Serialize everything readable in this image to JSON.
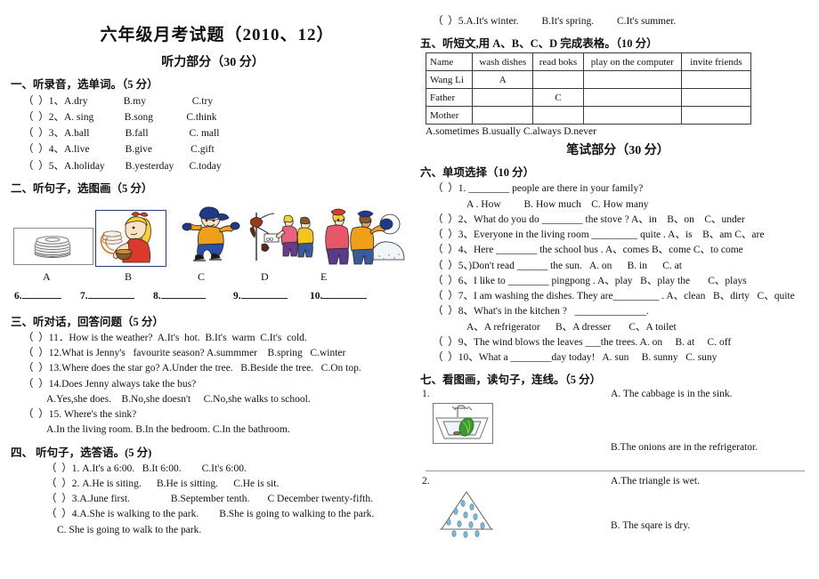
{
  "title": "六年级月考试题（2010、12）",
  "parts": {
    "listening": "听力部分（30 分）",
    "written": "笔试部分（30 分）"
  },
  "section1": {
    "heading": "一、听录音，选单词。（5 分）",
    "items": [
      "（  ）1、A.dry              B.my                  C.try",
      "（  ）2、A. sing            B.song             C.think",
      "（  ）3、A.ball              B.fall                C. mall",
      "（  ）4、A.live              B.give               C.gift",
      "（  ）5、A.holiday        B.yesterday      C.today"
    ]
  },
  "section2": {
    "heading": "二、听句子，选图画（5 分）",
    "pictures": [
      {
        "id": "A",
        "alt": "stack-of-plates"
      },
      {
        "id": "B",
        "alt": "girl-carrying-dishes"
      },
      {
        "id": "C",
        "alt": "ice-skater"
      },
      {
        "id": "D",
        "alt": "children-at-stand"
      },
      {
        "id": "E",
        "alt": "children-with-snowman"
      }
    ],
    "labels": [
      "A",
      "B",
      "C",
      "D",
      "E"
    ],
    "blanks": [
      "6.",
      "7.",
      "8.",
      "9.",
      "10."
    ]
  },
  "section3": {
    "heading": "三、听对话，回答问题（5 分）",
    "items": [
      "（  ）11．How is the weather?  A.It's  hot.  B.It's  warm  C.It's  cold.",
      "（  ）12.What is Jenny's   favourite season? A.summmer    B.spring   C.winter",
      "（  ）13.Where does the star go? A.Under the tree.   B.Beside the tree.   C.On top.",
      "（  ）14.Does Jenny always take the bus?",
      "A.Yes,she does.    B.No,she doesn't     C.No,she walks to school.",
      "（  ）15. Where's the sink?",
      "A.In the living room. B.In the bedroom. C.In the bathroom."
    ]
  },
  "section4": {
    "heading": "四、   听句子，选答语。(5 分)",
    "items": [
      "（  ）1. A.It's a 6:00.   B.It 6:00.        C.It's 6:00.",
      "（  ）2. A.He is siting.      B.He is sitting.      C.He is sit.",
      "（  ）3.A.June first.                B.September tenth.       C December twenty-fifth.",
      "（  ）4.A.She is walking to the park.        B.She is going to walking to the park.",
      "C. She is going to walk to the park.",
      "（  ）5.A.It's winter.         B.It's spring.         C.It's summer."
    ]
  },
  "section5": {
    "heading": "五、听短文,用 A、B、C、D 完成表格。（10 分）",
    "table": {
      "headers": [
        "Name",
        "wash dishes",
        "read boks",
        "play on the computer",
        "invite friends"
      ],
      "rows": [
        [
          "Wang Li",
          "A",
          "",
          "",
          ""
        ],
        [
          "Father",
          "",
          "C",
          "",
          ""
        ],
        [
          "Mother",
          "",
          "",
          "",
          ""
        ]
      ]
    },
    "options": "A.sometimes     B.usually    C.always    D.never"
  },
  "section6": {
    "heading": "六、单项选择（10 分）",
    "items": [
      "（  ）1. ________ people are there in your family?",
      "A . How         B. How much    C. How many",
      "（  ）2、What do you do ________ the stove ? A、in    B、on    C、under",
      "（  ）3、Everyone in the living room _________ quite . A、is    B、am C、are",
      "（  ）4、Here ________ the school bus . A、comes B、come C、to come",
      "（  ）5、)Don't read ______ the sun.   A. on      B. in      C. at",
      "（  ）6、I like to ________ pingpong . A、play   B、play the       C、plays",
      "（  ）7、I am washing the dishes. They are_________ . A、clean   B、dirty   C、quite",
      "（  ）8、What's in the kitchen ?   ______________.",
      "A、A refrigerator      B、A dresser       C、A toilet",
      "（  ）9、The wind blows the leaves ___the trees. A. on     B. at     C. off",
      "（  ）10、What a ________day today!   A. sun     B. sunny   C. suny"
    ]
  },
  "section7": {
    "heading": "七、看图画，读句子，连线。（5 分）",
    "items": [
      {
        "num": "1.",
        "picture_alt": "sink-with-cabbage",
        "optionA": "A. The cabbage is in the sink.",
        "optionB": "B.The onions are in the refrigerator."
      },
      {
        "num": "2.",
        "picture_alt": "wet-triangle",
        "optionA": "A.The triangle is wet.",
        "optionB": "B. The sqare is   dry."
      }
    ]
  },
  "colors": {
    "ink": "#111111",
    "table_border": "#3a3a3a",
    "frame_blue": "#2b3c7a",
    "water_blue": "#7fb7d8",
    "jacket_orange": "#f0a018",
    "jacket_red": "#d93a2b",
    "jeans_blue": "#2b4fa8",
    "cabbage_green": "#3f9a2e",
    "hair_yellow": "#f2d23a"
  }
}
